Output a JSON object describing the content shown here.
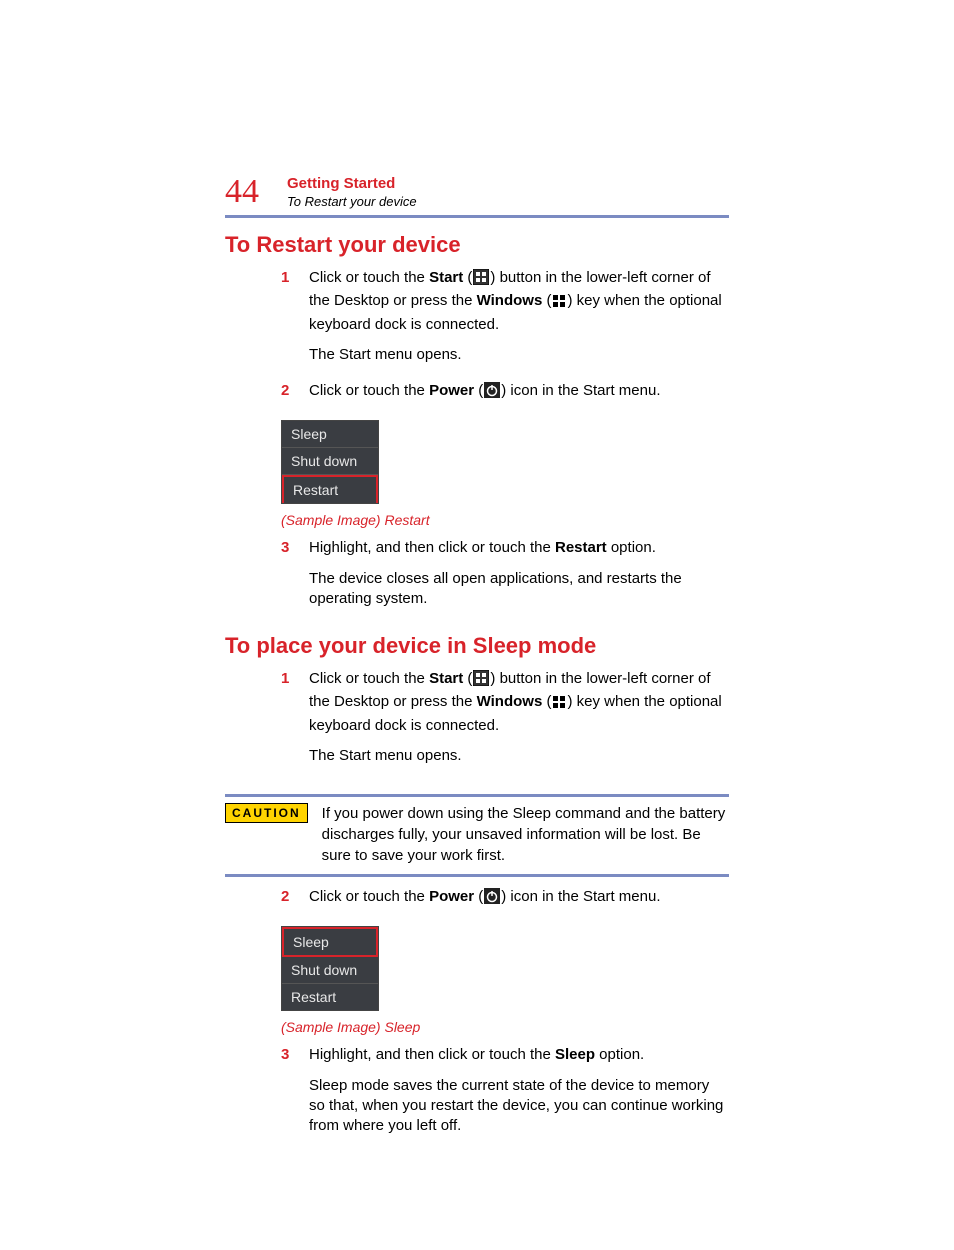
{
  "page_number": "44",
  "chapter": "Getting Started",
  "section_breadcrumb": "To Restart your device",
  "restart": {
    "heading": "To Restart your device",
    "step1_a": "Click or touch the ",
    "step1_b": "Start",
    "step1_c": " (",
    "step1_d": ") button in the lower-left corner of the Desktop or press the ",
    "step1_e": "Windows",
    "step1_f": " (",
    "step1_g": ") key when the optional keyboard dock is connected.",
    "step1_p2": "The Start menu opens.",
    "step2_a": "Click or touch the ",
    "step2_b": "Power",
    "step2_c": " (",
    "step2_d": ") icon in the Start menu.",
    "menu": {
      "sleep": "Sleep",
      "shutdown": "Shut down",
      "restart": "Restart"
    },
    "caption": "(Sample Image) Restart",
    "step3_a": "Highlight, and then click or touch the ",
    "step3_b": "Restart",
    "step3_c": " option.",
    "step3_p2": "The device closes all open applications, and restarts the operating system."
  },
  "sleep": {
    "heading": "To place your device in Sleep mode",
    "step1_a": "Click or touch the ",
    "step1_b": "Start",
    "step1_c": " (",
    "step1_d": ") button in the lower-left corner of the Desktop or press the ",
    "step1_e": "Windows",
    "step1_f": " (",
    "step1_g": ") key when the optional keyboard dock is connected.",
    "step1_p2": "The Start menu opens.",
    "caution_label": "CAUTION",
    "caution_text": "If you power down using the Sleep command and the battery discharges fully, your unsaved information will be lost. Be sure to save your work first.",
    "step2_a": "Click or touch the ",
    "step2_b": "Power",
    "step2_c": " (",
    "step2_d": ") icon in the Start menu.",
    "menu": {
      "sleep": "Sleep",
      "shutdown": "Shut down",
      "restart": "Restart"
    },
    "caption": "(Sample Image) Sleep",
    "step3_a": "Highlight, and then click or touch the ",
    "step3_b": "Sleep",
    "step3_c": " option.",
    "step3_p2": "Sleep mode saves the current state of the device to memory so that, when you restart the device, you can continue working from where you left off."
  },
  "nums": {
    "n1": "1",
    "n2": "2",
    "n3": "3"
  }
}
